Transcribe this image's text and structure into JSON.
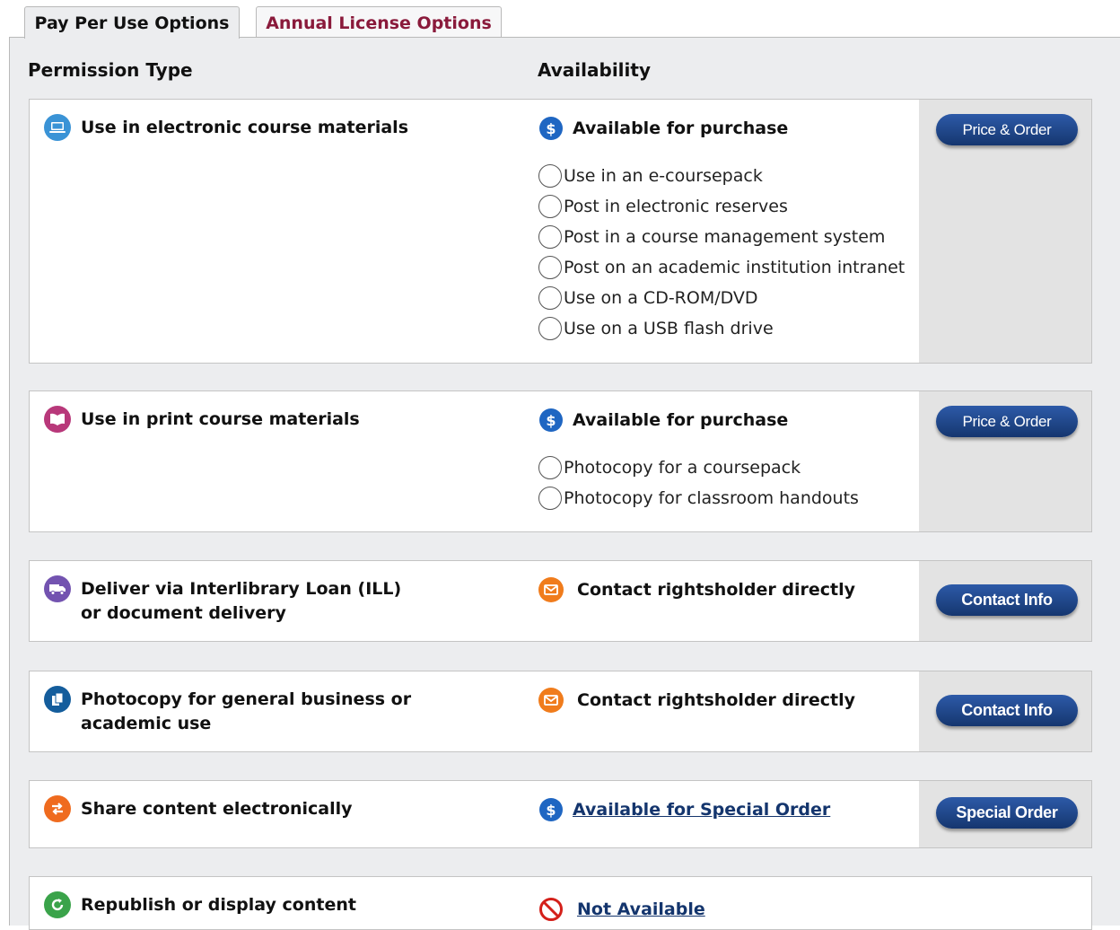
{
  "tabs": {
    "pay_per_use": "Pay Per Use Options",
    "annual_license": "Annual License Options"
  },
  "headers": {
    "permission_type": "Permission Type",
    "availability": "Availability"
  },
  "colors": {
    "inactive_tab_text": "#8a1a3b",
    "button_blue": "#1d438a",
    "dollar_blue": "#1f66c2",
    "contact_orange": "#f07c1c",
    "not_available_red": "#d4201a"
  },
  "rows": [
    {
      "permission": "Use in electronic course materials",
      "icon": "laptop-icon",
      "availability": "Available for purchase",
      "availability_icon": "dollar-icon",
      "options": [
        "Use in an e-coursepack",
        "Post in electronic reserves",
        "Post in a course management system",
        "Post on an academic institution intranet",
        "Use on a CD-ROM/DVD",
        "Use on a USB flash drive"
      ],
      "button": "Price & Order"
    },
    {
      "permission": "Use in print course materials",
      "icon": "book-icon",
      "availability": "Available for purchase",
      "availability_icon": "dollar-icon",
      "options": [
        "Photocopy for a coursepack",
        "Photocopy for classroom handouts"
      ],
      "button": "Price & Order"
    },
    {
      "permission": "Deliver via Interlibrary Loan (ILL) or document delivery",
      "icon": "truck-icon",
      "availability": "Contact rightsholder directly",
      "availability_icon": "envelope-icon",
      "button": "Contact Info"
    },
    {
      "permission": "Photocopy for general business or academic use",
      "icon": "copy-icon",
      "availability": "Contact rightsholder directly",
      "availability_icon": "envelope-icon",
      "button": "Contact Info"
    },
    {
      "permission": "Share content electronically",
      "icon": "share-arrows-icon",
      "availability": "Available for Special Order",
      "availability_icon": "dollar-icon",
      "button": "Special Order"
    },
    {
      "permission": "Republish or display content",
      "icon": "refresh-icon",
      "availability": "Not Available",
      "availability_icon": "prohibited-icon"
    }
  ]
}
